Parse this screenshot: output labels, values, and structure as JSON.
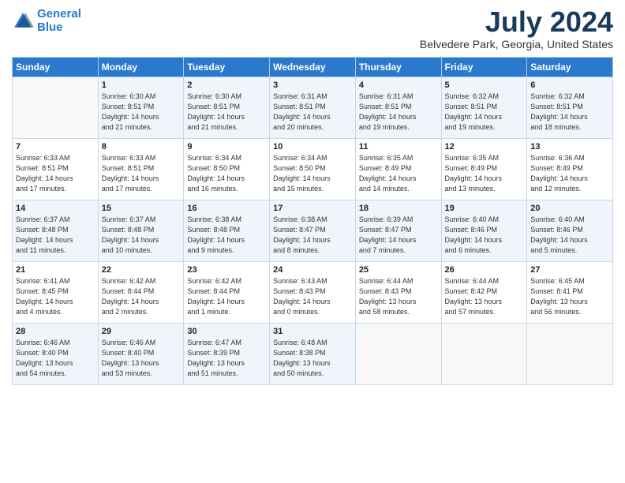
{
  "logo": {
    "line1": "General",
    "line2": "Blue"
  },
  "title": "July 2024",
  "location": "Belvedere Park, Georgia, United States",
  "days_of_week": [
    "Sunday",
    "Monday",
    "Tuesday",
    "Wednesday",
    "Thursday",
    "Friday",
    "Saturday"
  ],
  "weeks": [
    [
      {
        "day": "",
        "info": ""
      },
      {
        "day": "1",
        "info": "Sunrise: 6:30 AM\nSunset: 8:51 PM\nDaylight: 14 hours\nand 21 minutes."
      },
      {
        "day": "2",
        "info": "Sunrise: 6:30 AM\nSunset: 8:51 PM\nDaylight: 14 hours\nand 21 minutes."
      },
      {
        "day": "3",
        "info": "Sunrise: 6:31 AM\nSunset: 8:51 PM\nDaylight: 14 hours\nand 20 minutes."
      },
      {
        "day": "4",
        "info": "Sunrise: 6:31 AM\nSunset: 8:51 PM\nDaylight: 14 hours\nand 19 minutes."
      },
      {
        "day": "5",
        "info": "Sunrise: 6:32 AM\nSunset: 8:51 PM\nDaylight: 14 hours\nand 19 minutes."
      },
      {
        "day": "6",
        "info": "Sunrise: 6:32 AM\nSunset: 8:51 PM\nDaylight: 14 hours\nand 18 minutes."
      }
    ],
    [
      {
        "day": "7",
        "info": "Sunrise: 6:33 AM\nSunset: 8:51 PM\nDaylight: 14 hours\nand 17 minutes."
      },
      {
        "day": "8",
        "info": "Sunrise: 6:33 AM\nSunset: 8:51 PM\nDaylight: 14 hours\nand 17 minutes."
      },
      {
        "day": "9",
        "info": "Sunrise: 6:34 AM\nSunset: 8:50 PM\nDaylight: 14 hours\nand 16 minutes."
      },
      {
        "day": "10",
        "info": "Sunrise: 6:34 AM\nSunset: 8:50 PM\nDaylight: 14 hours\nand 15 minutes."
      },
      {
        "day": "11",
        "info": "Sunrise: 6:35 AM\nSunset: 8:49 PM\nDaylight: 14 hours\nand 14 minutes."
      },
      {
        "day": "12",
        "info": "Sunrise: 6:35 AM\nSunset: 8:49 PM\nDaylight: 14 hours\nand 13 minutes."
      },
      {
        "day": "13",
        "info": "Sunrise: 6:36 AM\nSunset: 8:49 PM\nDaylight: 14 hours\nand 12 minutes."
      }
    ],
    [
      {
        "day": "14",
        "info": "Sunrise: 6:37 AM\nSunset: 8:48 PM\nDaylight: 14 hours\nand 11 minutes."
      },
      {
        "day": "15",
        "info": "Sunrise: 6:37 AM\nSunset: 8:48 PM\nDaylight: 14 hours\nand 10 minutes."
      },
      {
        "day": "16",
        "info": "Sunrise: 6:38 AM\nSunset: 8:48 PM\nDaylight: 14 hours\nand 9 minutes."
      },
      {
        "day": "17",
        "info": "Sunrise: 6:38 AM\nSunset: 8:47 PM\nDaylight: 14 hours\nand 8 minutes."
      },
      {
        "day": "18",
        "info": "Sunrise: 6:39 AM\nSunset: 8:47 PM\nDaylight: 14 hours\nand 7 minutes."
      },
      {
        "day": "19",
        "info": "Sunrise: 6:40 AM\nSunset: 8:46 PM\nDaylight: 14 hours\nand 6 minutes."
      },
      {
        "day": "20",
        "info": "Sunrise: 6:40 AM\nSunset: 8:46 PM\nDaylight: 14 hours\nand 5 minutes."
      }
    ],
    [
      {
        "day": "21",
        "info": "Sunrise: 6:41 AM\nSunset: 8:45 PM\nDaylight: 14 hours\nand 4 minutes."
      },
      {
        "day": "22",
        "info": "Sunrise: 6:42 AM\nSunset: 8:44 PM\nDaylight: 14 hours\nand 2 minutes."
      },
      {
        "day": "23",
        "info": "Sunrise: 6:42 AM\nSunset: 8:44 PM\nDaylight: 14 hours\nand 1 minute."
      },
      {
        "day": "24",
        "info": "Sunrise: 6:43 AM\nSunset: 8:43 PM\nDaylight: 14 hours\nand 0 minutes."
      },
      {
        "day": "25",
        "info": "Sunrise: 6:44 AM\nSunset: 8:43 PM\nDaylight: 13 hours\nand 58 minutes."
      },
      {
        "day": "26",
        "info": "Sunrise: 6:44 AM\nSunset: 8:42 PM\nDaylight: 13 hours\nand 57 minutes."
      },
      {
        "day": "27",
        "info": "Sunrise: 6:45 AM\nSunset: 8:41 PM\nDaylight: 13 hours\nand 56 minutes."
      }
    ],
    [
      {
        "day": "28",
        "info": "Sunrise: 6:46 AM\nSunset: 8:40 PM\nDaylight: 13 hours\nand 54 minutes."
      },
      {
        "day": "29",
        "info": "Sunrise: 6:46 AM\nSunset: 8:40 PM\nDaylight: 13 hours\nand 53 minutes."
      },
      {
        "day": "30",
        "info": "Sunrise: 6:47 AM\nSunset: 8:39 PM\nDaylight: 13 hours\nand 51 minutes."
      },
      {
        "day": "31",
        "info": "Sunrise: 6:48 AM\nSunset: 8:38 PM\nDaylight: 13 hours\nand 50 minutes."
      },
      {
        "day": "",
        "info": ""
      },
      {
        "day": "",
        "info": ""
      },
      {
        "day": "",
        "info": ""
      }
    ]
  ]
}
